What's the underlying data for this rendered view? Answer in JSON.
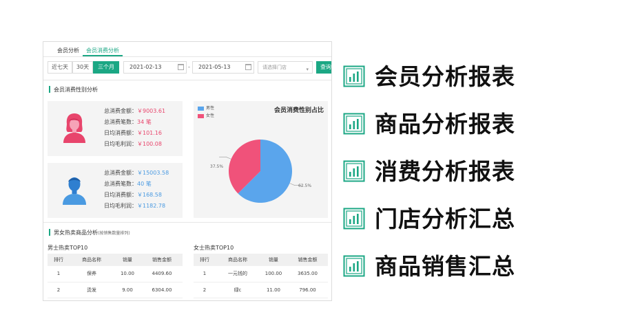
{
  "panel": {
    "tabs": [
      {
        "label": "会员分析"
      },
      {
        "label": "会员消费分析"
      }
    ],
    "filters": {
      "ranges": [
        {
          "label": "近七天"
        },
        {
          "label": "30天"
        },
        {
          "label": "三个月"
        }
      ],
      "active_range": "三个月",
      "start_date": "2021-02-13",
      "end_date": "2021-05-13",
      "date_separator": "-",
      "store_select_placeholder": "请选择门店",
      "query_button": "查询"
    },
    "gender_section": {
      "title": "会员消费性别分析",
      "female": {
        "rows": [
          {
            "label": "总消费金额：",
            "value": "￥9003.61"
          },
          {
            "label": "总消费笔数：",
            "value": "34 笔"
          },
          {
            "label": "日均消费额：",
            "value": "￥101.16"
          },
          {
            "label": "日均毛利润：",
            "value": "￥100.08"
          }
        ]
      },
      "male": {
        "rows": [
          {
            "label": "总消费金额：",
            "value": "￥15003.58"
          },
          {
            "label": "总消费笔数：",
            "value": "40 笔"
          },
          {
            "label": "日均消费额：",
            "value": "￥168.58"
          },
          {
            "label": "日均毛利润：",
            "value": "￥1182.78"
          }
        ]
      }
    },
    "hot_section": {
      "title": "男女热卖商品分析",
      "subtitle": "(按销售数量排列)",
      "male_table": {
        "caption": "男士热卖TOP10",
        "headers": [
          "排行",
          "商品名称",
          "销量",
          "销售金额"
        ],
        "rows": [
          [
            "1",
            "保养",
            "10.00",
            "4409.60"
          ],
          [
            "2",
            "烫发",
            "9.00",
            "6304.00"
          ]
        ]
      },
      "female_table": {
        "caption": "女士热卖TOP10",
        "headers": [
          "排行",
          "商品名称",
          "销量",
          "销售金额"
        ],
        "rows": [
          [
            "1",
            "一元钱的",
            "100.00",
            "3635.00"
          ],
          [
            "2",
            "绿c",
            "11.00",
            "796.00"
          ]
        ]
      }
    }
  },
  "chart_data": {
    "type": "pie",
    "title": "会员消费性别占比",
    "legend_placement": "top-left",
    "slices": [
      {
        "name": "男性",
        "value": 62.5,
        "label": "62.5%",
        "color": "#5aa5ec"
      },
      {
        "name": "女性",
        "value": 37.5,
        "label": "37.5%",
        "color": "#f0527a"
      }
    ]
  },
  "features": [
    {
      "label": "会员分析报表",
      "icon": "report-chart-icon"
    },
    {
      "label": "商品分析报表",
      "icon": "report-chart-icon"
    },
    {
      "label": "消费分析报表",
      "icon": "report-chart-icon"
    },
    {
      "label": "门店分析汇总",
      "icon": "report-chart-icon"
    },
    {
      "label": "商品销售汇总",
      "icon": "report-chart-icon"
    }
  ],
  "colors": {
    "accent": "#1ba784",
    "female": "#e8456c",
    "male": "#4a9ae1"
  }
}
